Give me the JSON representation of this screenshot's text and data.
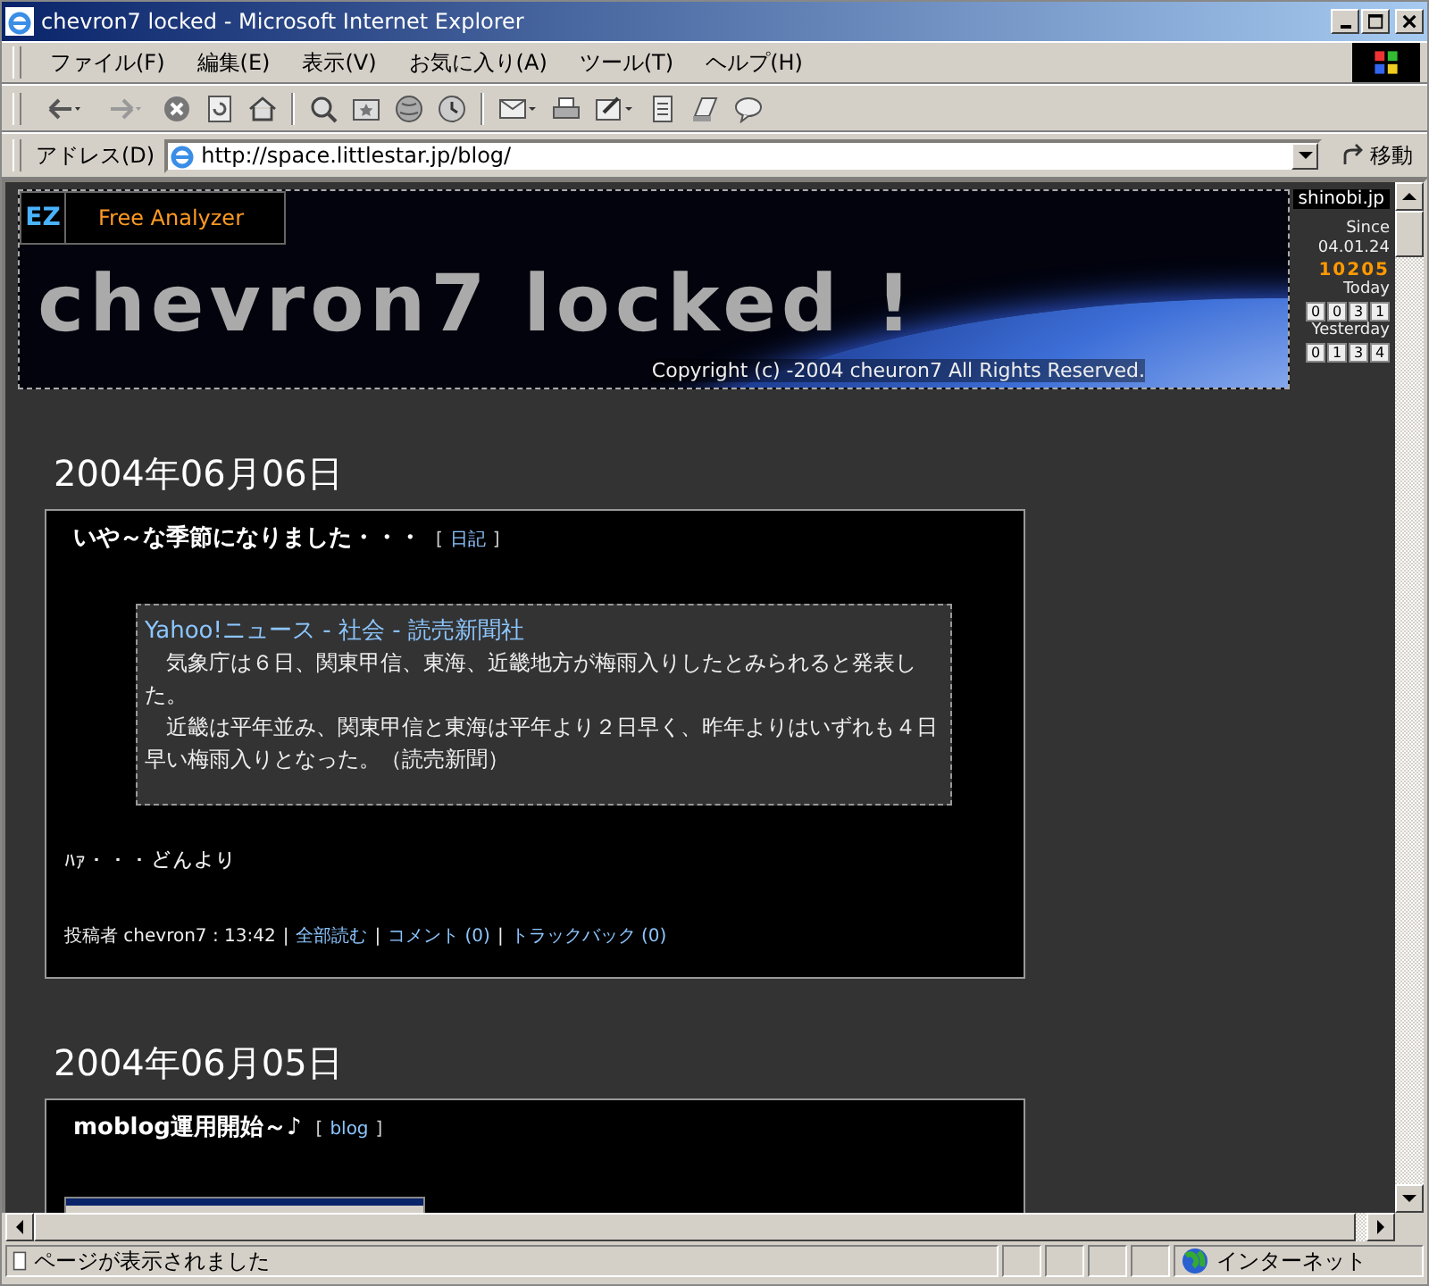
{
  "window": {
    "title": "chevron7 locked - Microsoft Internet Explorer"
  },
  "menu": [
    "ファイル(F)",
    "編集(E)",
    "表示(V)",
    "お気に入り(A)",
    "ツール(T)",
    "ヘルプ(H)"
  ],
  "address": {
    "label": "アドレス(D)",
    "value": "http://space.littlestar.jp/blog/",
    "go": "移動"
  },
  "page": {
    "analyzer": {
      "badge": "EZ",
      "label": "Free Analyzer"
    },
    "banner": {
      "title": "chevron7 locked !",
      "copyright": "Copyright (c) -2004 cheuron7 All Rights Reserved."
    },
    "counter": {
      "site": "shinobi.jp",
      "since_label": "Since",
      "since": "04.01.24",
      "total": "10205",
      "today_label": "Today",
      "today": [
        "0",
        "0",
        "3",
        "1"
      ],
      "yesterday_label": "Yesterday",
      "yesterday": [
        "0",
        "1",
        "3",
        "4"
      ]
    },
    "posts": [
      {
        "kind": "quote",
        "date": "2004年06月06日",
        "title": "いや～な季節になりました・・・",
        "category": {
          "open": "[",
          "label": "日記",
          "close": "]"
        },
        "quote": {
          "source": "Yahoo!ニュース - 社会 - 読売新聞社",
          "paragraphs": [
            "　気象庁は６日、関東甲信、東海、近畿地方が梅雨入りしたとみられると発表した。",
            "　近畿は平年並み、関東甲信と東海は平年より２日早く、昨年よりはいずれも４日早い梅雨入りとなった。（読売新聞）"
          ]
        },
        "body": "ﾊｧ・・・どんより",
        "footer": {
          "author": "投稿者 chevron7 : 13:42",
          "separator": "|",
          "links": [
            "全部読む",
            "コメント (0)",
            "トラックバック (0)"
          ]
        }
      },
      {
        "kind": "image",
        "date": "2004年06月05日",
        "title": "moblog運用開始～♪",
        "category": {
          "open": "[",
          "label": "blog",
          "close": "]"
        }
      }
    ]
  },
  "status_bar": {
    "text": "ページが表示されました",
    "zone": "インターネット"
  }
}
